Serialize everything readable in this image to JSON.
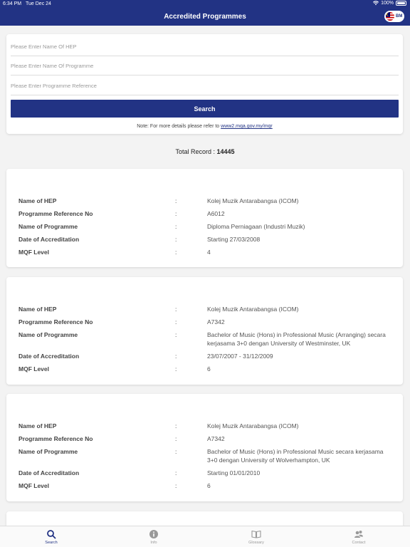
{
  "status_bar": {
    "time": "6:34 PM",
    "date": "Tue Dec 24",
    "battery": "100%"
  },
  "header": {
    "title": "Accredited Programmes",
    "language": "BM"
  },
  "search": {
    "hep_placeholder": "Please Enter Name Of HEP",
    "programme_placeholder": "Please Enter Name Of Programme",
    "reference_placeholder": "Please Enter Programme Reference",
    "button_label": "Search",
    "note_text": "Note: For more details please refer to ",
    "note_link": "www2.mqa.gov.my/mqr"
  },
  "total": {
    "label": "Total Record : ",
    "value": "14445"
  },
  "field_labels": {
    "hep": "Name of HEP",
    "ref": "Programme Reference No",
    "programme": "Name of Programme",
    "date": "Date of Accreditation",
    "mqf": "MQF Level",
    "colon": ":"
  },
  "records": [
    {
      "hep": "Kolej Muzik Antarabangsa (ICOM)",
      "ref": "A6012",
      "programme": "Diploma Perniagaan (Industri Muzik)",
      "date": "Starting 27/03/2008",
      "mqf": "4"
    },
    {
      "hep": "Kolej Muzik Antarabangsa (ICOM)",
      "ref": "A7342",
      "programme": "Bachelor of Music (Hons) in Professional Music (Arranging) secara kerjasama 3+0 dengan University of Westminster, UK",
      "date": "23/07/2007 - 31/12/2009",
      "mqf": "6"
    },
    {
      "hep": "Kolej Muzik Antarabangsa (ICOM)",
      "ref": "A7342",
      "programme": "Bachelor of Music (Hons) in Professional Music secara kerjasama 3+0 dengan University of Wolverhampton, UK",
      "date": "Starting 01/01/2010",
      "mqf": "6"
    }
  ],
  "tabs": [
    {
      "label": "Search",
      "icon": "search-icon",
      "active": true
    },
    {
      "label": "Info",
      "icon": "info-icon",
      "active": false
    },
    {
      "label": "Glossary",
      "icon": "book-icon",
      "active": false
    },
    {
      "label": "Contact",
      "icon": "contact-icon",
      "active": false
    }
  ],
  "colors": {
    "brand": "#223384",
    "background": "#f3f3f3"
  }
}
